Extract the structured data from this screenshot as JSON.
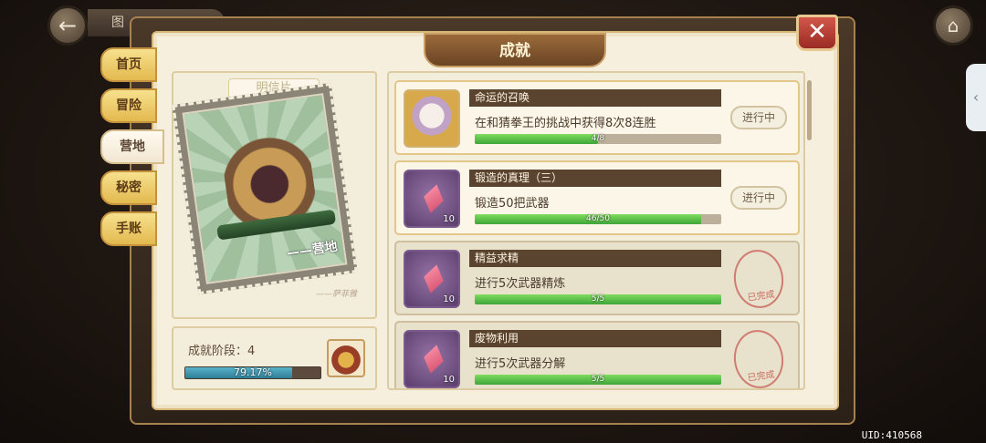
{
  "nav": {
    "back_icon": "back-arrow-icon",
    "prev_tab_hint": "图",
    "home_icon": "home-icon",
    "side_handle_icon": "chevron-left-icon"
  },
  "window": {
    "title": "成就",
    "close_icon": "close-icon"
  },
  "tabs": [
    {
      "label": "首页",
      "active": false
    },
    {
      "label": "冒险",
      "active": false
    },
    {
      "label": "营地",
      "active": true
    },
    {
      "label": "秘密",
      "active": false
    },
    {
      "label": "手账",
      "active": false
    }
  ],
  "postcard": {
    "label": "明信片",
    "caption": "——营地",
    "signature": "——萨菲雅"
  },
  "stage": {
    "label": "成就阶段：4",
    "progress_text": "79.17%",
    "progress": 0.7917,
    "reward_icon": "treasure-chest-icon"
  },
  "achievements": [
    {
      "title": "命运的召唤",
      "desc": "在和猜拳王的挑战中获得8次8连胜",
      "progress_text": "4/8",
      "progress": 0.5,
      "status": "进行中",
      "done": false,
      "icon": "character-avatar-icon",
      "reward": ""
    },
    {
      "title": "锻造的真理（三）",
      "desc": "锻造50把武器",
      "progress_text": "46/50",
      "progress": 0.92,
      "status": "进行中",
      "done": false,
      "icon": "pink-crystal-icon",
      "reward": "10"
    },
    {
      "title": "精益求精",
      "desc": "进行5次武器精炼",
      "progress_text": "5/5",
      "progress": 1.0,
      "status": "已完成",
      "done": true,
      "icon": "pink-crystal-icon",
      "reward": "10"
    },
    {
      "title": "废物利用",
      "desc": "进行5次武器分解",
      "progress_text": "5/5",
      "progress": 1.0,
      "status": "已完成",
      "done": true,
      "icon": "pink-crystal-icon",
      "reward": "10"
    }
  ],
  "uid": "UID:410568",
  "colors": {
    "accent_green": "#3fa63a",
    "stage_blue": "#2f7d97",
    "close_red": "#c0392b"
  }
}
